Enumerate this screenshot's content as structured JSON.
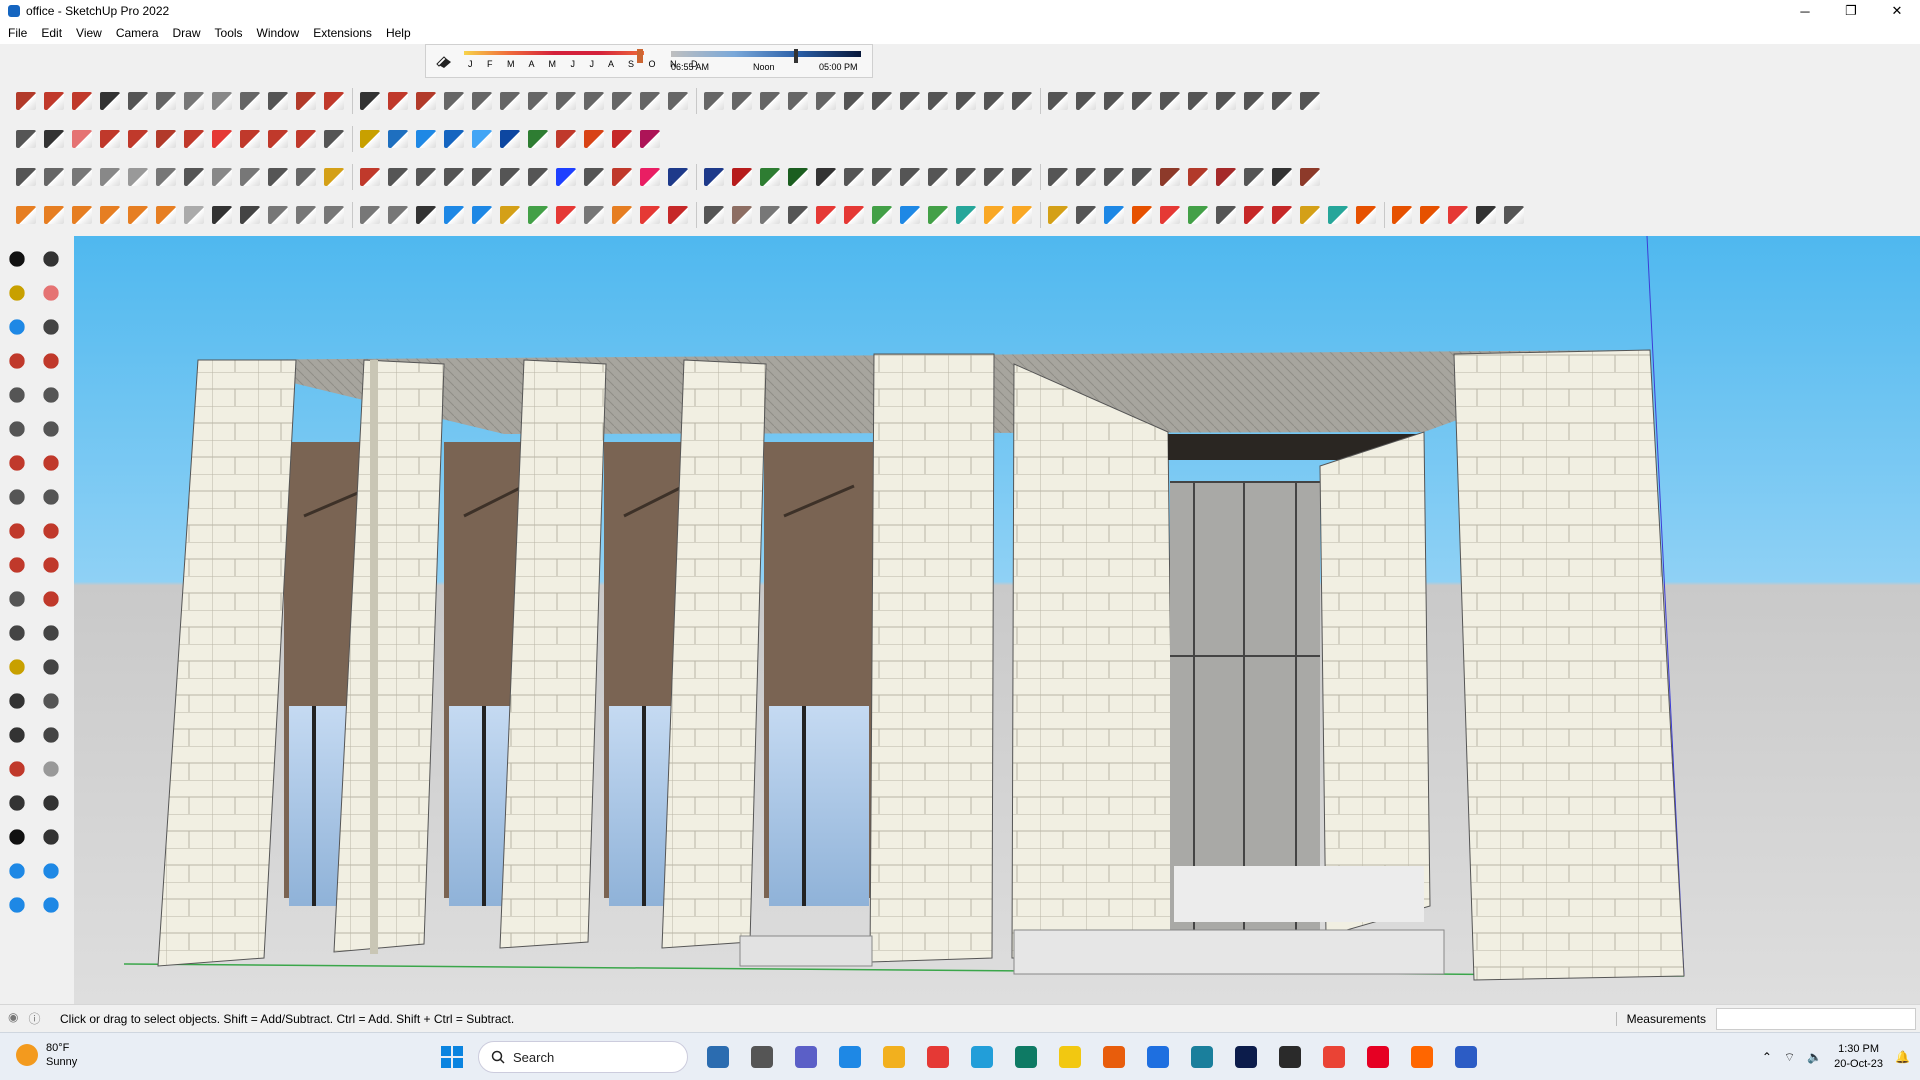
{
  "window": {
    "title": "office - SketchUp Pro 2022",
    "minimize_icon": "─",
    "maximize_icon": "❐",
    "close_icon": "✕"
  },
  "menu": [
    "File",
    "Edit",
    "View",
    "Camera",
    "Draw",
    "Tools",
    "Window",
    "Extensions",
    "Help"
  ],
  "shadows": {
    "months": "J F M A M J J A S O N D",
    "time_start": "06:55 AM",
    "time_mid": "Noon",
    "time_end": "05:00 PM",
    "month_value": 0.98,
    "time_value": 0.66
  },
  "toolbars": {
    "row1": [
      "#b23a2a",
      "#c0392b",
      "#c0392b",
      "#333",
      "#555",
      "#666",
      "#777",
      "#888",
      "#666",
      "#555",
      "#b23a2a",
      "#c0392b",
      "#333",
      "#c0392b",
      "#b23a2a",
      "#666",
      "#666",
      "#666",
      "#666",
      "#666",
      "#666",
      "#666",
      "#666",
      "#666",
      "#666",
      "#666",
      "#666",
      "#666",
      "#666",
      "#555",
      "#555",
      "#555",
      "#555",
      "#555",
      "#555",
      "#555",
      "#555",
      "#555",
      "#555",
      "#555",
      "#555",
      "#555",
      "#555",
      "#555",
      "#555",
      "#555"
    ],
    "row2": [
      "#555",
      "#333",
      "#e57373",
      "#c0392b",
      "#c0392b",
      "#b23a2a",
      "#c0392b",
      "#e53935",
      "#c0392b",
      "#c0392b",
      "#c0392b",
      "#555",
      "#c8a000",
      "#1e6fbf",
      "#1e88e5",
      "#1565c0",
      "#42a5f5",
      "#0d47a1",
      "#2e7d32",
      "#c0392b",
      "#d84315",
      "#c62828",
      "#ad1457"
    ],
    "row3": [
      "#555",
      "#666",
      "#777",
      "#888",
      "#999",
      "#777",
      "#555",
      "#888",
      "#777",
      "#555",
      "#666",
      "#d4a017",
      "#c0392b",
      "#555",
      "#555",
      "#555",
      "#555",
      "#555",
      "#555",
      "#1e40ff",
      "#555",
      "#c0392b",
      "#e91e63",
      "#1e3a8a",
      "#1e3a8a",
      "#b71c1c",
      "#2e7d32",
      "#1b5e20",
      "#333",
      "#555",
      "#555",
      "#555",
      "#555",
      "#555",
      "#555",
      "#555",
      "#555",
      "#555",
      "#555",
      "#555",
      "#8d3a2a",
      "#b23a2a",
      "#a52a2a",
      "#555",
      "#333",
      "#8d3a2a"
    ],
    "row4": [
      "#e67e22",
      "#e67e22",
      "#e67e22",
      "#e67e22",
      "#e67e22",
      "#e67e22",
      "#aaa",
      "#333",
      "#444",
      "#777",
      "#777",
      "#777",
      "#777",
      "#777",
      "#333",
      "#1e88e5",
      "#1e88e5",
      "#d4a017",
      "#43a047",
      "#e53935",
      "#777",
      "#e67e22",
      "#e53935",
      "#c62828",
      "#555",
      "#8d6e63",
      "#777",
      "#555",
      "#e53935",
      "#e53935",
      "#43a047",
      "#1e88e5",
      "#43a047",
      "#26a69a",
      "#f9a825",
      "#f9a825",
      "#d4a017",
      "#555",
      "#1e88e5",
      "#e65100",
      "#e53935",
      "#43a047",
      "#555",
      "#c62828",
      "#c62828",
      "#d4a017",
      "#26a69a",
      "#e65100",
      "#e65100",
      "#e65100",
      "#e53935",
      "#333",
      "#555"
    ]
  },
  "left_tools": [
    "select-arrow",
    "orbit",
    "paint-bucket",
    "eraser",
    "component",
    "tape-red",
    "line-pencil",
    "freehand",
    "rectangle",
    "rotated-rectangle",
    "circle",
    "polygon",
    "arc",
    "pie",
    "arc-3pt",
    "follow-me",
    "move",
    "push-pull",
    "rotate",
    "offset",
    "scale",
    "tape-measure",
    "dimension",
    "text",
    "protractor",
    "axes",
    "section-plane",
    "walk",
    "zoom",
    "zoom-window",
    "zoom-extents",
    "previous-view",
    "position-camera",
    "look-around",
    "footprints",
    "center-target",
    "layers",
    "styles",
    "scenes",
    "shadows-tool"
  ],
  "status": {
    "message": "Click or drag to select objects. Shift = Add/Subtract. Ctrl = Add. Shift + Ctrl = Subtract.",
    "measurements_label": "Measurements",
    "measurements_value": ""
  },
  "taskbar": {
    "temperature": "80°F",
    "condition": "Sunny",
    "search_placeholder": "Search",
    "time": "1:30 PM",
    "date": "20-Oct-23",
    "apps": [
      [
        "#2b6cb0",
        "widgets-app"
      ],
      [
        "#555",
        "file-manager"
      ],
      [
        "#5b5fc7",
        "teams-meet"
      ],
      [
        "#1e88e5",
        "calendar"
      ],
      [
        "#f2b01e",
        "file-explorer"
      ],
      [
        "#e53935",
        "opera-browser"
      ],
      [
        "#229ed9",
        "telegram"
      ],
      [
        "#0e7a64",
        "publisher"
      ],
      [
        "#f2c811",
        "sticky-notes"
      ],
      [
        "#e85d0c",
        "grammarly"
      ],
      [
        "#1e6fe0",
        "vscode"
      ],
      [
        "#1a7f9c",
        "sketchup-3d-warehouse"
      ],
      [
        "#0c1c4b",
        "photoshop"
      ],
      [
        "#2a2a2a",
        "google-drive"
      ],
      [
        "#ea4335",
        "chrome"
      ],
      [
        "#e60023",
        "pinterest"
      ],
      [
        "#ff6600",
        "soundcloud"
      ],
      [
        "#2c5cc5",
        "sketchup-active"
      ]
    ]
  }
}
